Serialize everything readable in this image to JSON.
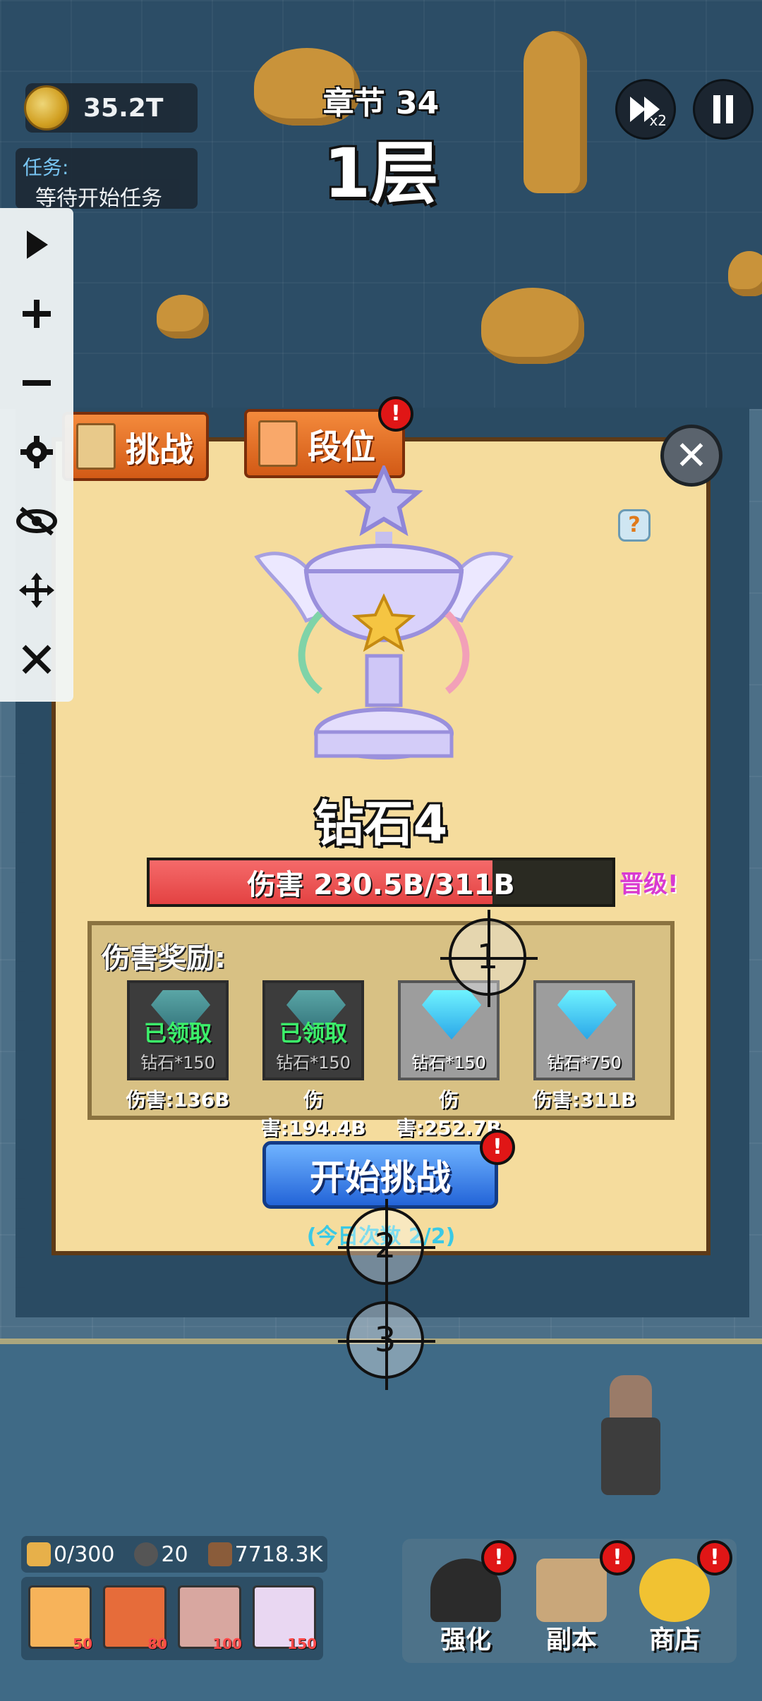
{
  "hud": {
    "coins": "35.2T",
    "task_title": "任务:",
    "task_status": "等待开始任务",
    "chapter": "章节 34",
    "floor": "1层",
    "speed_sub": "x2"
  },
  "tools": [
    "play-icon",
    "plus-icon",
    "minus-icon",
    "gear-icon",
    "eye-off-icon",
    "move-icon",
    "close-icon"
  ],
  "dialog": {
    "tabs": [
      {
        "label": "挑战"
      },
      {
        "label": "段位"
      }
    ],
    "badge": "!",
    "help": "?",
    "close": "✕",
    "rank": "钻石4",
    "progress": {
      "text": "伤害 230.5B/311B",
      "fraction": 0.741
    },
    "promote": "晋级!",
    "rewards_title": "伤害奖励:",
    "rewards": [
      {
        "status": "已领取",
        "amount": "钻石*150",
        "damage": "伤害:136B"
      },
      {
        "status": "已领取",
        "amount": "钻石*150",
        "damage": "伤害:194.4B"
      },
      {
        "status": "",
        "amount": "钻石*150",
        "damage": "伤害:252.7B"
      },
      {
        "status": "",
        "amount": "钻石*750",
        "damage": "伤害:311B"
      }
    ],
    "start_button": "开始挑战",
    "daily": "(今日次数 2/2)"
  },
  "crosshairs": [
    "1",
    "2",
    "3"
  ],
  "bottom": {
    "energy": "0/300",
    "stones": "20",
    "power": "7718.3K",
    "skills": [
      {
        "cost": "50"
      },
      {
        "cost": "80"
      },
      {
        "cost": "100"
      },
      {
        "cost": "150"
      }
    ],
    "menu": [
      {
        "label": "强化"
      },
      {
        "label": "副本"
      },
      {
        "label": "商店"
      }
    ]
  },
  "colors": {
    "accent_orange": "#e0631c",
    "dialog_bg": "#f5dc9d",
    "progress_red": "#e34242",
    "claimed_green": "#3cf06a",
    "promote_pink": "#d93ad1",
    "button_blue": "#2364d8"
  }
}
